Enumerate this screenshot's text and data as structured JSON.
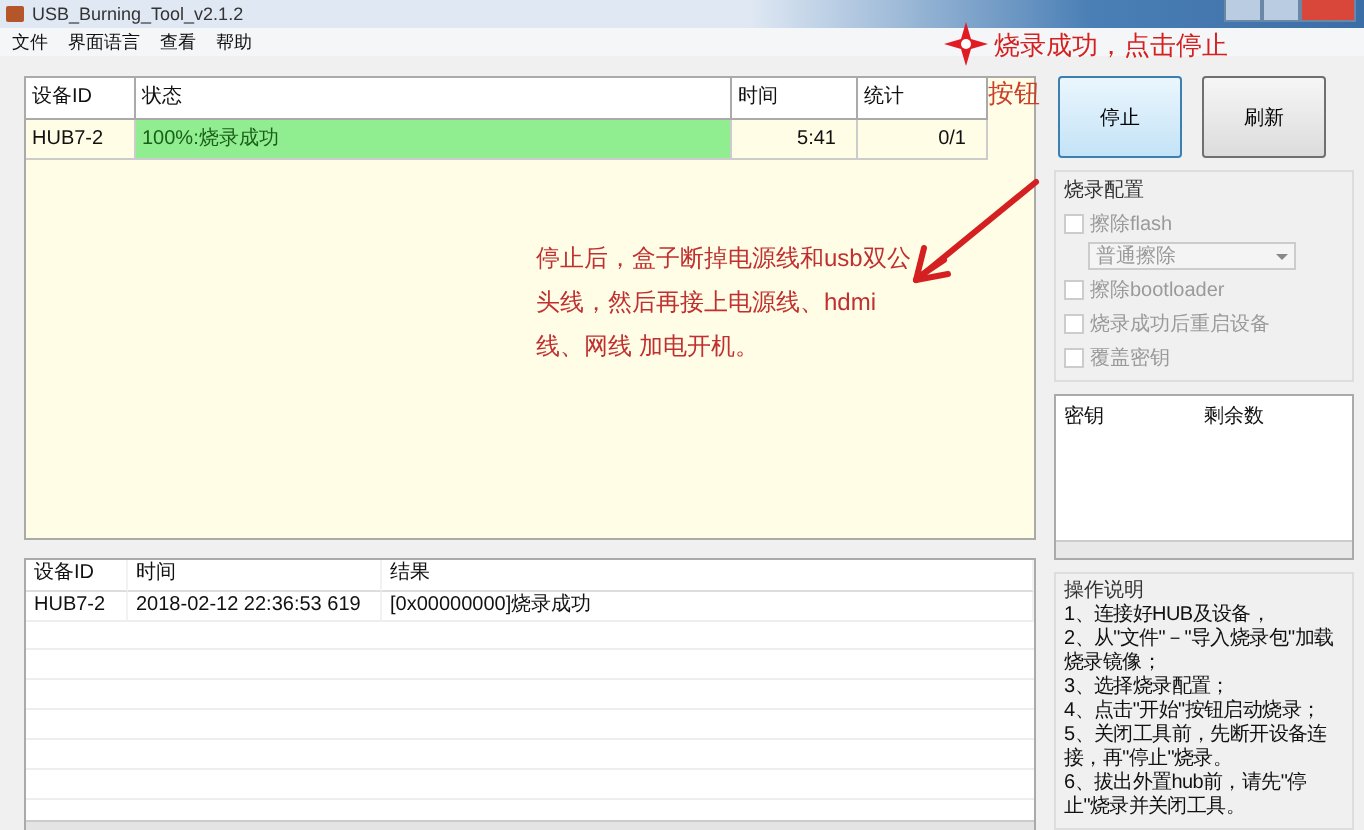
{
  "window": {
    "title": "USB_Burning_Tool_v2.1.2"
  },
  "menu": [
    "文件",
    "界面语言",
    "查看",
    "帮助"
  ],
  "devices": {
    "columns": [
      "设备ID",
      "状态",
      "时间",
      "统计"
    ],
    "rows": [
      {
        "id": "HUB7-2",
        "status": "100%:烧录成功",
        "level": 1,
        "time": "5:41",
        "count": "0/1"
      }
    ]
  },
  "log": {
    "columns": [
      "设备ID",
      "时间",
      "结果"
    ],
    "rows": [
      {
        "id": "HUB7-2",
        "time": "2018-02-12 22:36:53 619",
        "result": "[0x00000000]烧录成功"
      }
    ]
  },
  "buttons": [
    "停止",
    "刷新"
  ],
  "config": {
    "title": "烧录配置",
    "options": [
      {
        "kind": "checkbox",
        "label": "擦除flash",
        "checked": false,
        "disabled": true
      },
      {
        "kind": "dropdown",
        "value": "普通擦除",
        "disabled": true
      },
      {
        "kind": "checkbox",
        "label": "擦除bootloader",
        "checked": false,
        "disabled": true
      },
      {
        "kind": "checkbox",
        "label": "烧录成功后重启设备",
        "checked": false,
        "disabled": true
      },
      {
        "kind": "checkbox",
        "label": "覆盖密钥",
        "checked": false,
        "disabled": true
      }
    ]
  },
  "keys": {
    "columns": [
      "密钥",
      "剩余数"
    ]
  },
  "instructions": {
    "title": "操作说明",
    "items": [
      "1、连接好HUB及设备，",
      "2、从\"文件\"－\"导入烧录包\"加载烧录镜像；",
      "3、选择烧录配置；",
      "4、点击\"开始\"按钮启动烧录；",
      "5、关闭工具前，先断开设备连接，再\"停止\"烧录。",
      "6、拔出外置hub前，请先\"停止\"烧录并关闭工具。"
    ]
  },
  "annotations": {
    "callout": "烧录成功，点击停止",
    "callout_2": "按钮",
    "note": [
      "停止后，盒子断掉电源线和usb双公",
      "头线，然后再接上电源线、hdmi",
      "线、网线 加电开机。"
    ]
  }
}
